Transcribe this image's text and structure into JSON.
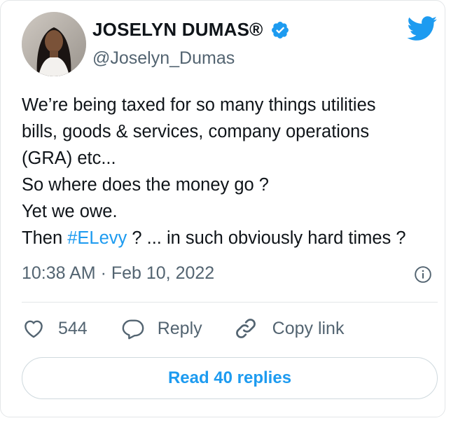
{
  "author": {
    "display_name": "JOSELYN DUMAS®",
    "handle": "@Joselyn_Dumas"
  },
  "tweet": {
    "lines": [
      "We’re being taxed for so many things utilities",
      "bills, goods & services, company operations",
      "(GRA) etc...",
      "So where does the money go ?",
      "Yet we owe."
    ],
    "last_line_prefix": "Then ",
    "hashtag": "#ELevy",
    "last_line_suffix": " ? ... in such obviously hard times ?",
    "timestamp": "10:38 AM · Feb 10, 2022"
  },
  "actions": {
    "like_count": "544",
    "reply_label": "Reply",
    "copy_label": "Copy link"
  },
  "footer": {
    "read_replies_label": "Read 40 replies"
  },
  "colors": {
    "accent": "#1d9bf0",
    "text": "#0f1419",
    "secondary": "#536471",
    "border": "#e3e6e8"
  },
  "icons": [
    "verified-badge-icon",
    "twitter-bird-icon",
    "info-icon",
    "heart-icon",
    "reply-bubble-icon",
    "link-icon"
  ]
}
